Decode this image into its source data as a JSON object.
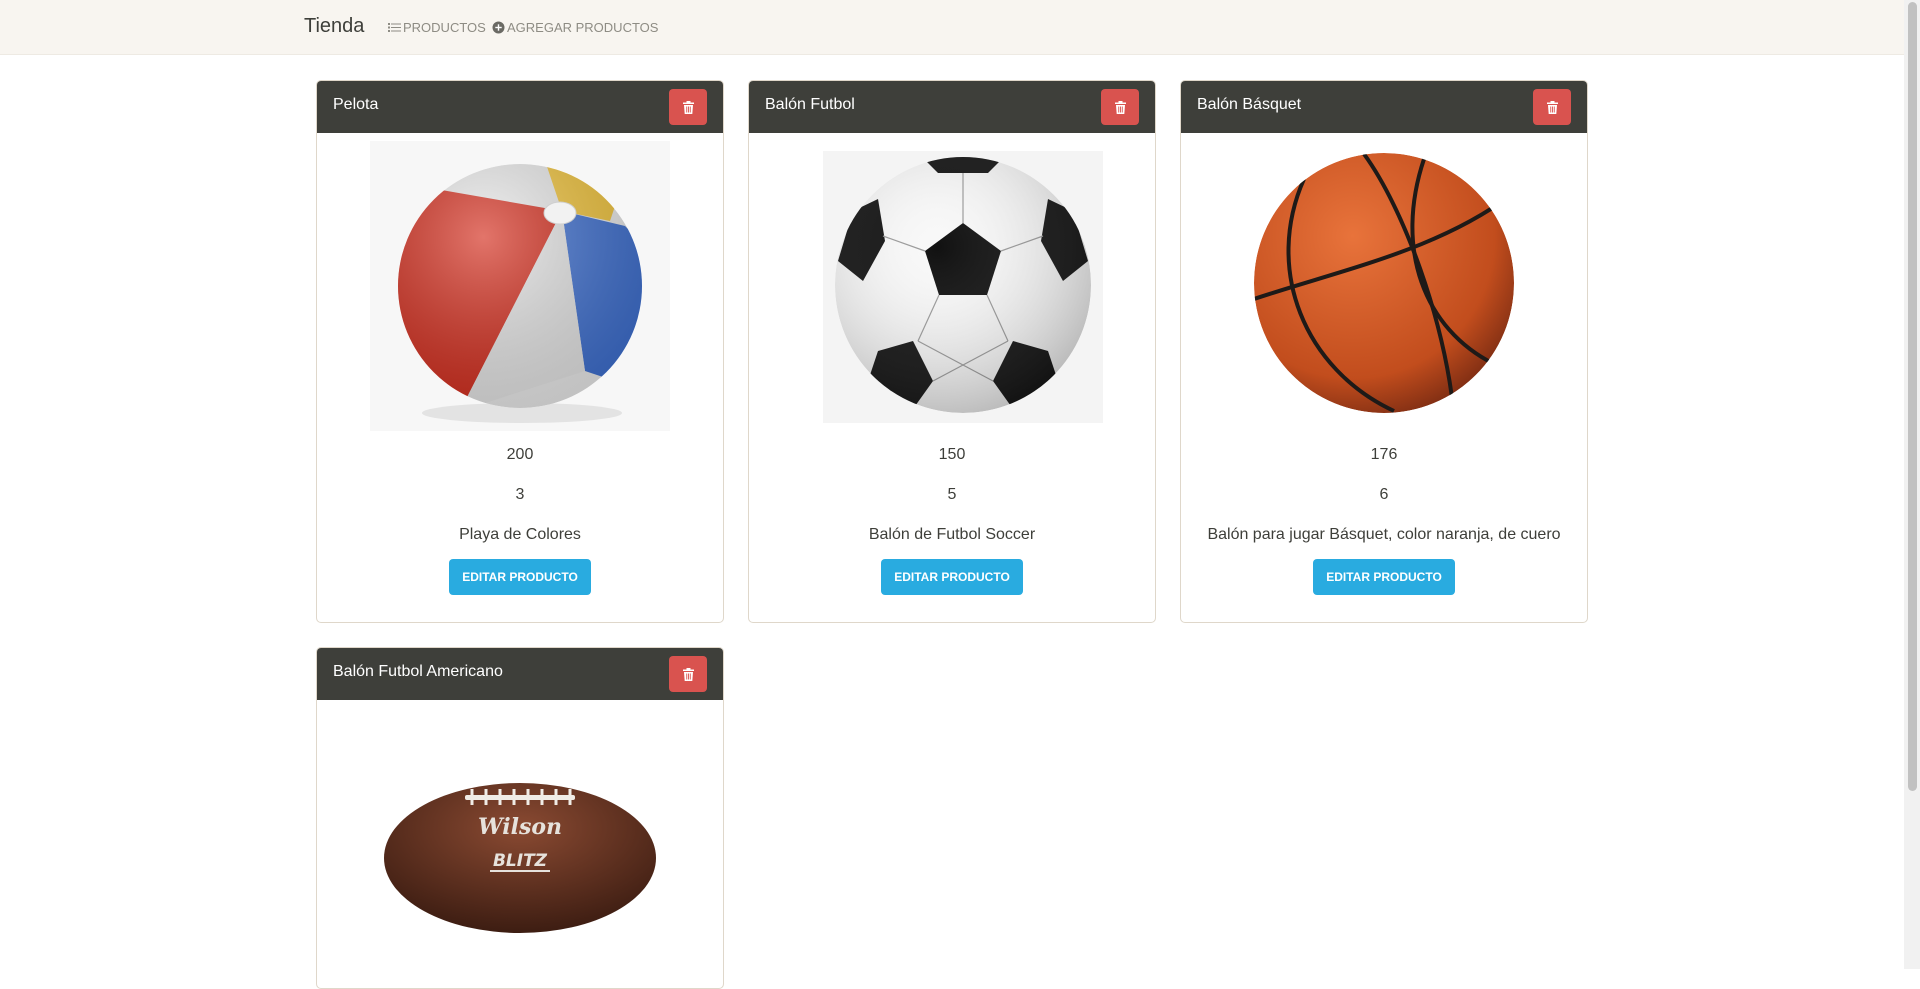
{
  "navbar": {
    "brand": "Tienda",
    "links": [
      {
        "label": "PRODUCTOS",
        "icon": "list-icon"
      },
      {
        "label": "AGREGAR PRODUCTOS",
        "icon": "plus-circle-icon"
      }
    ]
  },
  "products": [
    {
      "name": "Pelota",
      "price": "200",
      "quantity": "3",
      "description": "Playa de Colores",
      "image": "beach-ball"
    },
    {
      "name": "Balón Futbol",
      "price": "150",
      "quantity": "5",
      "description": "Balón de Futbol Soccer",
      "image": "soccer-ball"
    },
    {
      "name": "Balón Básquet",
      "price": "176",
      "quantity": "6",
      "description": "Balón para jugar Básquet, color naranja, de cuero",
      "image": "basketball"
    },
    {
      "name": "Balón Futbol Americano",
      "image": "american-football",
      "image_brand_text": "Wilson",
      "image_model_text": "BLITZ"
    }
  ],
  "buttons": {
    "edit_label": "EDITAR PRODUCTO",
    "delete_icon": "trash-icon"
  },
  "colors": {
    "navbar_bg": "#f8f5f0",
    "card_header_bg": "#3e3f3a",
    "delete_button": "#d9534f",
    "edit_button": "#29abe0"
  }
}
